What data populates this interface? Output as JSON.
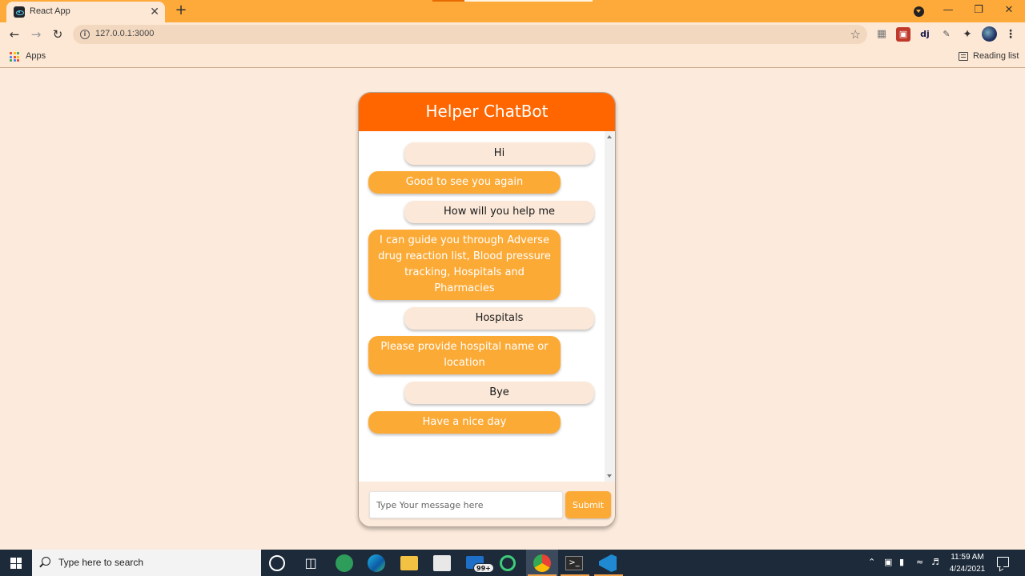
{
  "browser": {
    "tab": {
      "title": "React App",
      "close": "✕"
    },
    "new_tab": "+",
    "address": "127.0.0.1:3000",
    "bookmarks": {
      "apps_label": "Apps",
      "reading_list_label": "Reading list"
    },
    "extensions": [
      "chart-icon",
      "pdf-icon",
      "dj-icon",
      "pen-icon",
      "puzzle-icon"
    ],
    "ext_dj_text": "dj"
  },
  "chat": {
    "title": "Helper ChatBot",
    "messages": [
      {
        "from": "user",
        "text": "Hi"
      },
      {
        "from": "bot",
        "text": "Good to see you again"
      },
      {
        "from": "user",
        "text": "How will you help me"
      },
      {
        "from": "bot",
        "text": "I can guide you through Adverse drug reaction list, Blood pressure tracking, Hospitals and Pharmacies"
      },
      {
        "from": "user",
        "text": "Hospitals"
      },
      {
        "from": "bot",
        "text": "Please provide hospital name or location"
      },
      {
        "from": "user",
        "text": "Bye"
      },
      {
        "from": "bot",
        "text": "Have a nice day"
      }
    ],
    "input": {
      "placeholder": "Type Your message here",
      "value": ""
    },
    "submit_label": "Submit"
  },
  "taskbar": {
    "search_placeholder": "Type here to search",
    "mail_badge": "99+",
    "time": "11:59 AM",
    "date": "4/24/2021"
  },
  "colors": {
    "header": "#ff6600",
    "bot_bubble": "#fcaa36",
    "user_bubble": "#fbe8d8",
    "page_bg": "#fcebdc",
    "browser_frame": "#feaa3a"
  }
}
